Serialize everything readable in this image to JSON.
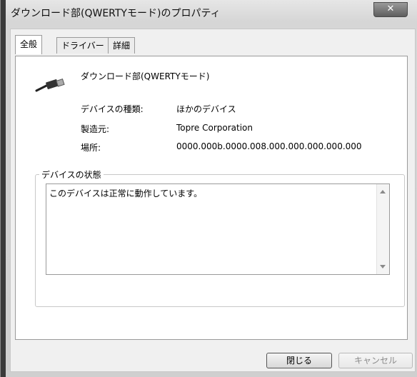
{
  "window": {
    "title": "ダウンロード部(QWERTYモード)のプロパティ",
    "close_label": "✕"
  },
  "tabs": [
    {
      "label": "全般",
      "active": true
    },
    {
      "label": "ドライバー",
      "active": false
    },
    {
      "label": "詳細",
      "active": false
    }
  ],
  "general": {
    "device_icon": "usb-plug-icon",
    "device_name": "ダウンロード部(QWERTYモード)",
    "properties": [
      {
        "label": "デバイスの種類:",
        "value": "ほかのデバイス"
      },
      {
        "label": "製造元:",
        "value": "Topre Corporation"
      },
      {
        "label": "場所:",
        "value": "0000.000b.0000.008.000.000.000.000.000"
      }
    ],
    "status_group_label": "デバイスの状態",
    "status_text": "このデバイスは正常に動作しています。"
  },
  "buttons": {
    "close": "閉じる",
    "cancel": "キャンセル"
  }
}
